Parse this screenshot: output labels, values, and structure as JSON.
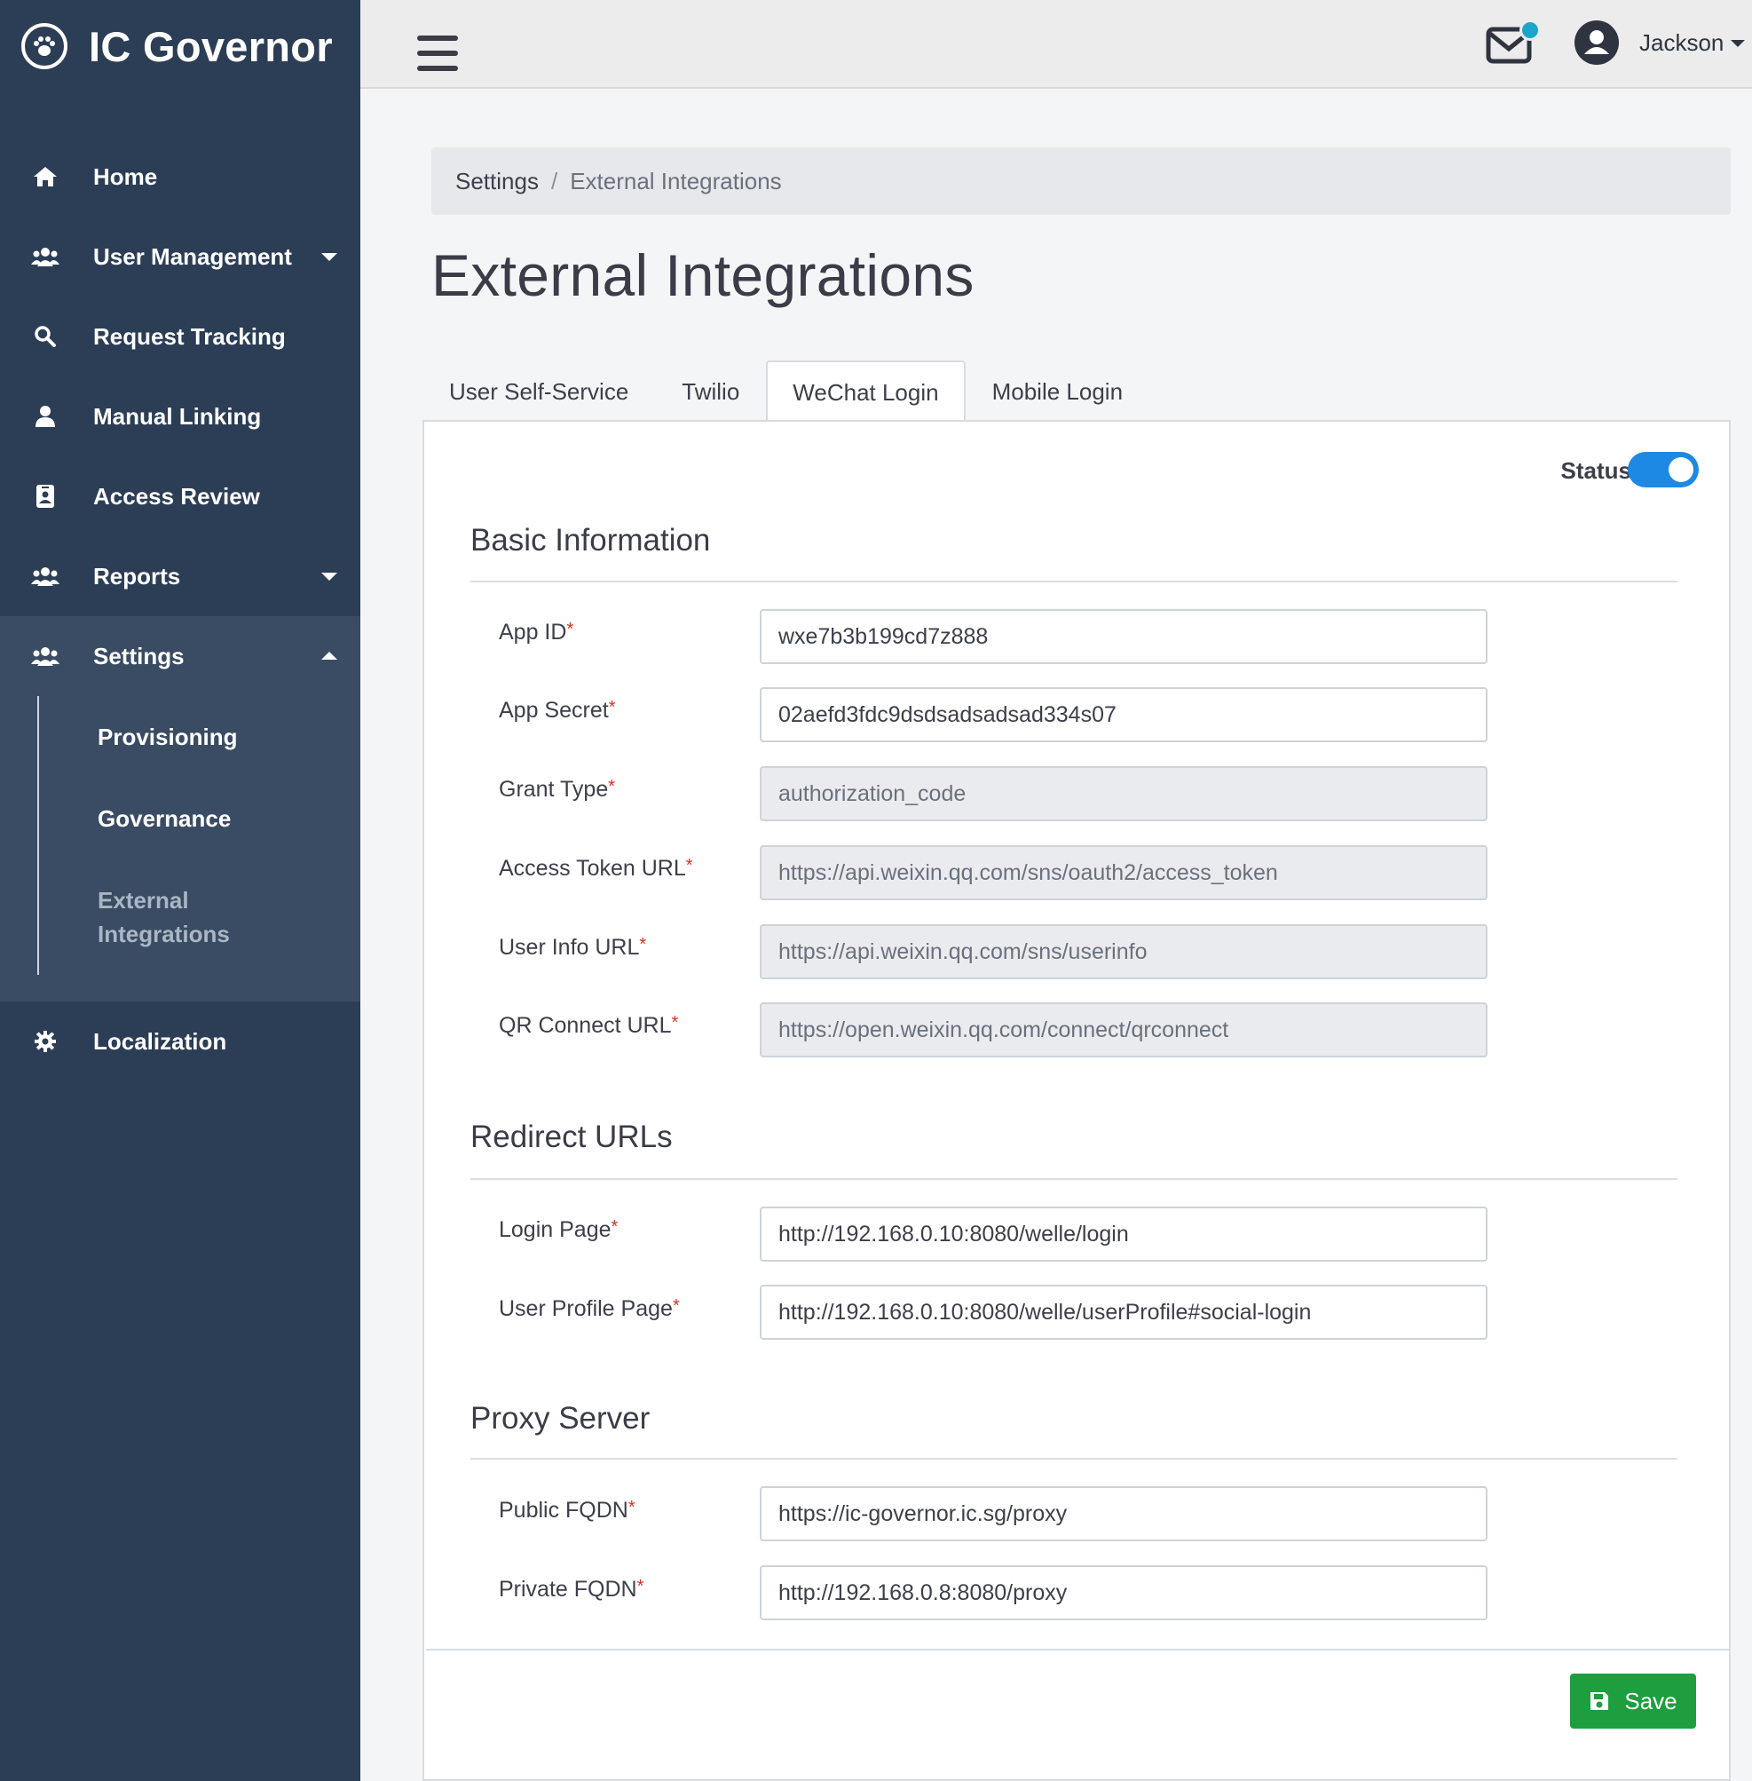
{
  "app": {
    "title": "IC Governor"
  },
  "sidebar": {
    "items": [
      {
        "label": "Home",
        "icon": "home-icon"
      },
      {
        "label": "User Management",
        "icon": "users-icon"
      },
      {
        "label": "Request Tracking",
        "icon": "search-icon"
      },
      {
        "label": "Manual Linking",
        "icon": "user-icon"
      },
      {
        "label": "Access Review",
        "icon": "id-badge-icon"
      },
      {
        "label": "Reports",
        "icon": "users-icon"
      },
      {
        "label": "Settings",
        "icon": "users-icon"
      },
      {
        "label": "Localization",
        "icon": "gear-icon"
      }
    ],
    "settings_sub": [
      {
        "label": "Provisioning"
      },
      {
        "label": "Governance"
      },
      {
        "label": "External Integrations"
      }
    ]
  },
  "topbar": {
    "user_name": "Jackson"
  },
  "breadcrumb": {
    "parent": "Settings",
    "separator": "/",
    "current": "External Integrations"
  },
  "page": {
    "title": "External Integrations"
  },
  "tabs": [
    {
      "label": "User Self-Service"
    },
    {
      "label": "Twilio"
    },
    {
      "label": "WeChat Login"
    },
    {
      "label": "Mobile Login"
    }
  ],
  "status": {
    "label": "Status",
    "enabled": true
  },
  "sections": {
    "basic": {
      "title": "Basic Information",
      "fields": [
        {
          "label": "App ID",
          "value": "wxe7b3b199cd7z888",
          "readonly": false
        },
        {
          "label": "App Secret",
          "value": "02aefd3fdc9dsdsadsadsad334s07",
          "readonly": false
        },
        {
          "label": "Grant Type",
          "value": "authorization_code",
          "readonly": true
        },
        {
          "label": "Access Token URL",
          "value": "https://api.weixin.qq.com/sns/oauth2/access_token",
          "readonly": true
        },
        {
          "label": "User Info URL",
          "value": "https://api.weixin.qq.com/sns/userinfo",
          "readonly": true
        },
        {
          "label": "QR Connect URL",
          "value": "https://open.weixin.qq.com/connect/qrconnect",
          "readonly": true
        }
      ]
    },
    "redirect": {
      "title": "Redirect URLs",
      "fields": [
        {
          "label": "Login Page",
          "value": "http://192.168.0.10:8080/welle/login",
          "readonly": false
        },
        {
          "label": "User Profile Page",
          "value": "http://192.168.0.10:8080/welle/userProfile#social-login",
          "readonly": false
        }
      ]
    },
    "proxy": {
      "title": "Proxy Server",
      "fields": [
        {
          "label": "Public FQDN",
          "value": "https://ic-governor.ic.sg/proxy",
          "readonly": false
        },
        {
          "label": "Private FQDN",
          "value": "http://192.168.0.8:8080/proxy",
          "readonly": false
        }
      ]
    }
  },
  "required_marker": "*",
  "save_button": {
    "label": "Save"
  },
  "colors": {
    "sidebar": "#2c3e55",
    "accent": "#1e88e5",
    "save": "#1e9e3e",
    "badge": "#1aa6c9"
  }
}
